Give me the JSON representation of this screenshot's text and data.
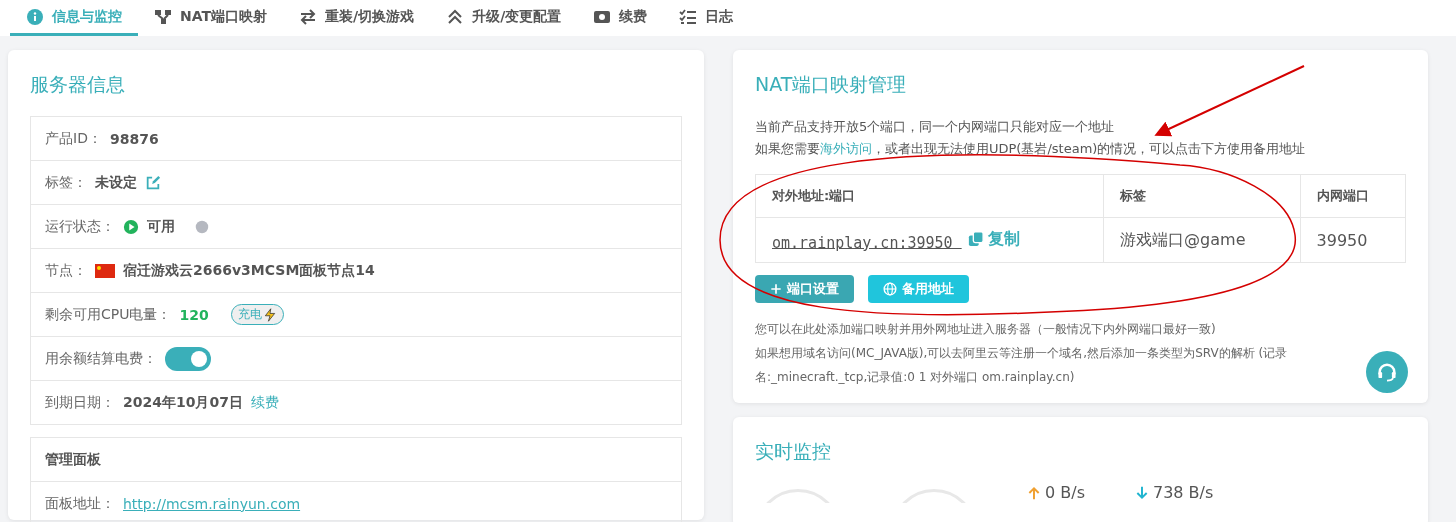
{
  "tabs": [
    {
      "label": "信息与监控",
      "selected": true
    },
    {
      "label": "NAT端口映射",
      "selected": false
    },
    {
      "label": "重装/切换游戏",
      "selected": false
    },
    {
      "label": "升级/变更配置",
      "selected": false
    },
    {
      "label": "续费",
      "selected": false
    },
    {
      "label": "日志",
      "selected": false
    }
  ],
  "server_info": {
    "title": "服务器信息",
    "rows": [
      {
        "kind": "text",
        "label": "产品ID：",
        "value": "98876"
      },
      {
        "kind": "edit",
        "label": "标签：",
        "value": "未设定"
      },
      {
        "kind": "status",
        "label": "运行状态：",
        "value": "可用"
      },
      {
        "kind": "node",
        "label": "节点：",
        "value": "宿迁游戏云2666v3MCSM面板节点14"
      },
      {
        "kind": "cpu",
        "label": "剩余可用CPU电量：",
        "value": "120",
        "action": "充电"
      },
      {
        "kind": "toggle",
        "label": "用余额结算电费：",
        "on": true
      },
      {
        "kind": "expiry",
        "label": "到期日期：",
        "value": "2024年10月07日",
        "action": "续费"
      }
    ]
  },
  "panel": {
    "title": "管理面板",
    "address_label": "面板地址：",
    "address": "http://mcsm.rainyun.com"
  },
  "nat": {
    "title": "NAT端口映射管理",
    "note": "当前产品支持开放5个端口，同一个内网端口只能对应一个地址",
    "note2": {
      "before": "如果您需要",
      "link": "海外访问",
      "after": "，或者出现无法使用UDP(基岩/steam)的情况，可以点击下方使用备用地址"
    },
    "columns": [
      "对外地址:端口",
      "标签",
      "内网端口"
    ],
    "rows": [
      {
        "address": "om.rainplay.cn:39950 ",
        "copy": "复制",
        "tag": "游戏端口@game",
        "inner_port": "39950"
      }
    ],
    "buttons": [
      {
        "kind": "add",
        "label": "端口设置"
      },
      {
        "kind": "globe",
        "label": "备用地址"
      }
    ],
    "footnotes": [
      "您可以在此处添加端口映射并用外网地址进入服务器（一般情况下内外网端口最好一致)",
      "如果想用域名访问(MC_JAVA版),可以去阿里云等注册一个域名,然后添加一条类型为SRV的解析 (记录名:_minecraft._tcp,记录值:0 1 对外端口 om.rainplay.cn)"
    ]
  },
  "monitor": {
    "title": "实时监控",
    "upload": "0 B/s",
    "download": "738 B/s"
  }
}
